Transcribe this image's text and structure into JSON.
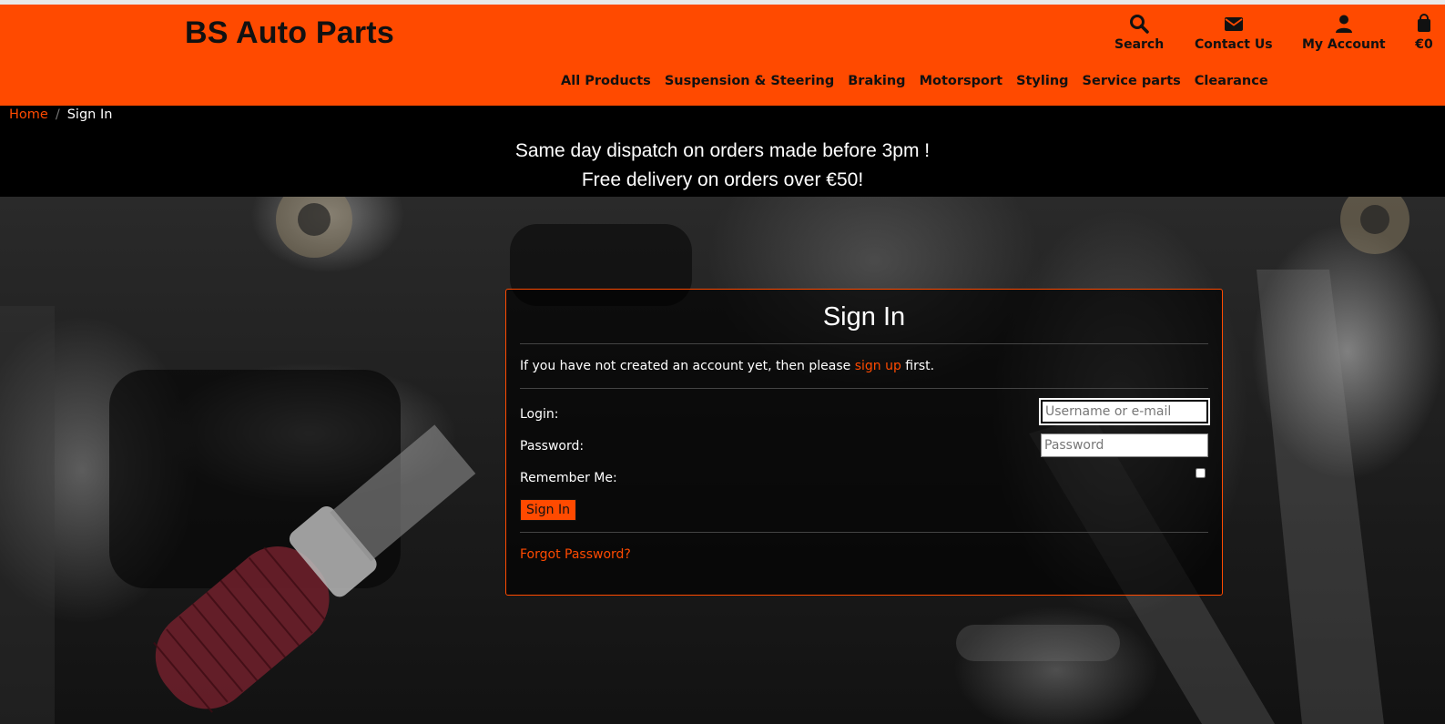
{
  "brand": "BS Auto Parts",
  "tools": [
    {
      "icon": "search-icon",
      "label": "Search"
    },
    {
      "icon": "envelope-icon",
      "label": "Contact Us"
    },
    {
      "icon": "user-icon",
      "label": "My Account"
    },
    {
      "icon": "cart-icon",
      "label": "€0"
    }
  ],
  "nav": [
    "All Products",
    "Suspension & Steering",
    "Braking",
    "Motorsport",
    "Styling",
    "Service parts",
    "Clearance"
  ],
  "breadcrumb": {
    "home": "Home",
    "sep": "/",
    "current": "Sign In"
  },
  "banner": {
    "line1": "Same day dispatch on orders made before 3pm !",
    "line2": "Free delivery on orders over €50!"
  },
  "signin": {
    "title": "Sign In",
    "intro_pre": "If you have not created an account yet, then please ",
    "intro_link": "sign up",
    "intro_post": " first.",
    "login_label": "Login:",
    "login_placeholder": "Username or e-mail",
    "password_label": "Password:",
    "password_placeholder": "Password",
    "remember_label": "Remember Me:",
    "remember_checked": false,
    "submit": "Sign In",
    "forgot": "Forgot Password?"
  },
  "colors": {
    "accent": "#ff4a00",
    "text_dark": "#111111",
    "bg": "#000000"
  }
}
